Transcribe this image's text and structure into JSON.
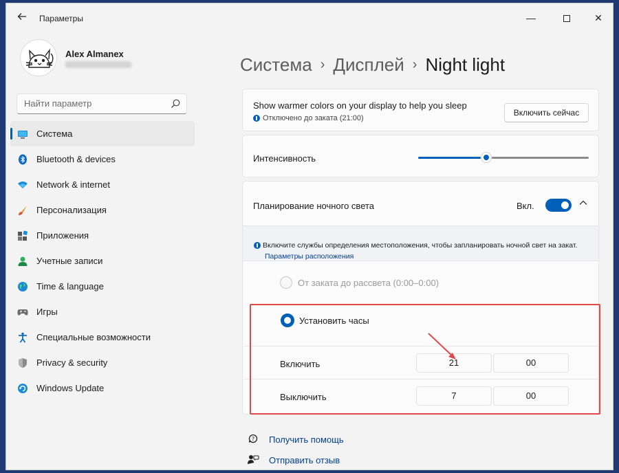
{
  "window": {
    "title": "Параметры",
    "back_icon": "back-arrow-icon",
    "minimize_label": "—",
    "close_label": "✕"
  },
  "user": {
    "name": "Alex Almanex"
  },
  "search": {
    "placeholder": "Найти параметр"
  },
  "nav": {
    "items": [
      {
        "label": "Система",
        "icon": "system-icon",
        "active": true
      },
      {
        "label": "Bluetooth & devices",
        "icon": "bluetooth-icon"
      },
      {
        "label": "Network & internet",
        "icon": "network-icon"
      },
      {
        "label": "Персонализация",
        "icon": "brush-icon"
      },
      {
        "label": "Приложения",
        "icon": "apps-icon"
      },
      {
        "label": "Учетные записи",
        "icon": "accounts-icon"
      },
      {
        "label": "Time & language",
        "icon": "globe-icon"
      },
      {
        "label": "Игры",
        "icon": "gamepad-icon"
      },
      {
        "label": "Специальные возможности",
        "icon": "accessibility-icon"
      },
      {
        "label": "Privacy & security",
        "icon": "shield-icon"
      },
      {
        "label": "Windows Update",
        "icon": "update-icon"
      }
    ]
  },
  "breadcrumb": {
    "items": [
      "Система",
      "Дисплей",
      "Night light"
    ],
    "separator": "›"
  },
  "night_light": {
    "description": "Show warmer colors on your display to help you sleep",
    "status": "Отключено до заката (21:00)",
    "turn_on_now": "Включить сейчас",
    "intensity_label": "Интенсивность",
    "intensity_value": 0.4,
    "schedule_label": "Планирование ночного света",
    "schedule_toggle_label": "Вкл.",
    "schedule_enabled": true,
    "location_notice": "Включите службы определения местоположения, чтобы запланировать ночной свет на закат.",
    "location_link": "Параметры расположения",
    "sunset_option": "От заката до рассвета (0:00–0:00)",
    "set_hours_option": "Установить часы",
    "turn_on_label": "Включить",
    "turn_on_hour": "21",
    "turn_on_minute": "00",
    "turn_off_label": "Выключить",
    "turn_off_hour": "7",
    "turn_off_minute": "00"
  },
  "footer": {
    "help": "Получить помощь",
    "feedback": "Отправить отзыв"
  },
  "colors": {
    "accent": "#005fb8",
    "highlight": "#e0484a",
    "link": "#003e92"
  }
}
